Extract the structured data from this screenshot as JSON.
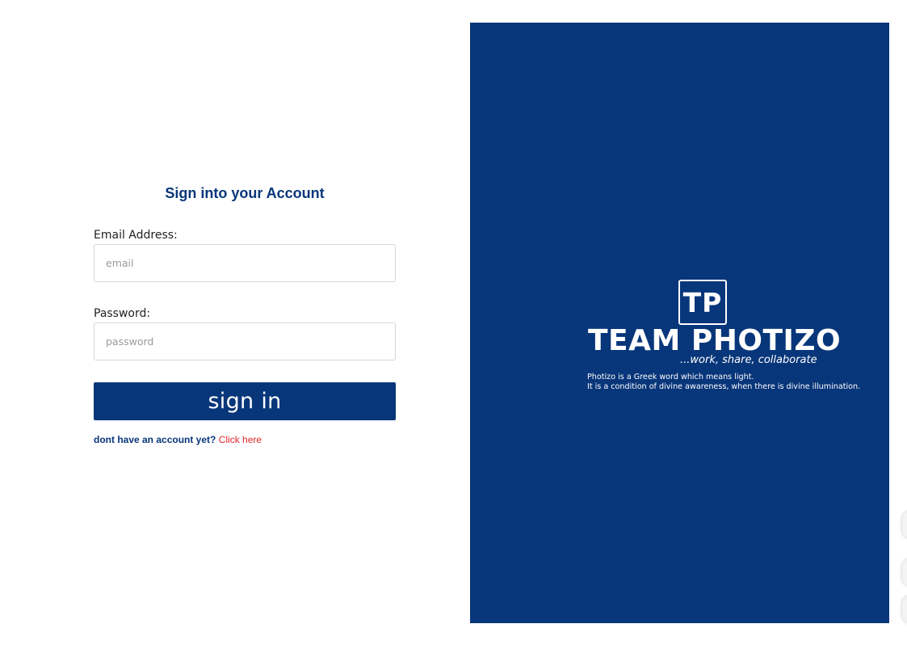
{
  "login": {
    "title": "Sign into your Account",
    "email_label": "Email Address:",
    "email_placeholder": "email",
    "password_label": "Password:",
    "password_placeholder": "password",
    "signin_label": "sign in",
    "signup_question": "dont have an account yet?",
    "signup_link": "Click here"
  },
  "brand": {
    "logo_text": "TP",
    "name": "TEAM PHOTIZO",
    "tagline": "...work, share, collaborate",
    "description_line1": "Photizo is a Greek word which means light.",
    "description_line2": "It is a condition of divine awareness, when there is divine illumination."
  },
  "colors": {
    "brand_blue": "#08367a",
    "link_red": "#e0262b",
    "input_border": "#d6d6d6"
  }
}
